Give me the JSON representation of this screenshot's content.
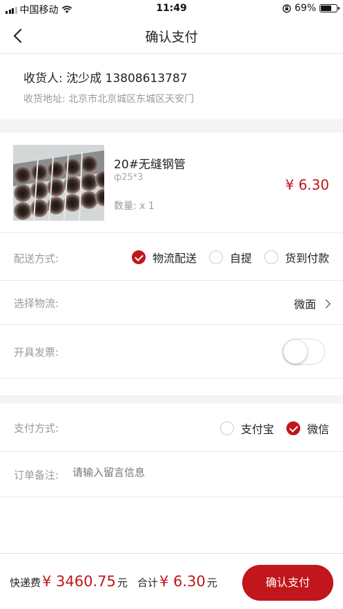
{
  "status_bar": {
    "carrier": "中国移动",
    "time": "11:49",
    "battery": "69%",
    "battery_level": 0.69
  },
  "nav": {
    "title": "确认支付",
    "back_icon": "chevron-left-icon"
  },
  "address": {
    "recipient": "收货人: 沈少成 13808613787",
    "location": "收货地址: 北京市北京城区东城区天安门"
  },
  "product": {
    "name": "20#无缝钢管",
    "spec": "ф25*3",
    "quantity": "数量: x 1",
    "price": "¥ 6.30"
  },
  "delivery": {
    "label": "配送方式:",
    "options": [
      {
        "label": "物流配送",
        "selected": true
      },
      {
        "label": "自提",
        "selected": false
      },
      {
        "label": "货到付款",
        "selected": false
      }
    ]
  },
  "logistics": {
    "label": "选择物流:",
    "value": "微面"
  },
  "invoice": {
    "label": "开具发票:",
    "enabled": false
  },
  "payment": {
    "label": "支付方式:",
    "options": [
      {
        "label": "支付宝",
        "selected": false
      },
      {
        "label": "微信",
        "selected": true
      }
    ]
  },
  "remark": {
    "label": "订单备注:",
    "placeholder": "请输入留言信息"
  },
  "footer": {
    "shipping_label": "快递费",
    "shipping_amount": "¥ 3460.75",
    "shipping_unit": "元",
    "total_label": "合计",
    "total_amount": "¥ 6.30",
    "total_unit": "元",
    "confirm_button": "确认支付"
  },
  "colors": {
    "accent": "#c0161c",
    "muted_text": "#999999",
    "divider": "#e8e8e8"
  }
}
